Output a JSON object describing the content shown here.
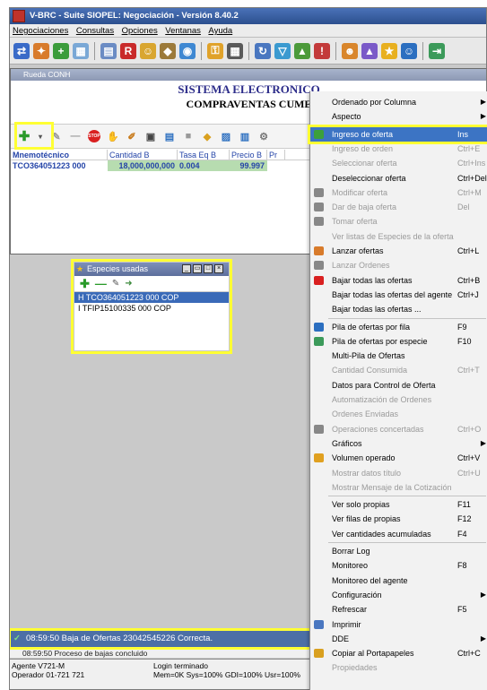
{
  "window": {
    "title": "V-BRC - Suite SIOPEL: Negociación - Versión 8.40.2"
  },
  "menubar": [
    "Negociaciones",
    "Consultas",
    "Opciones",
    "Ventanas",
    "Ayuda"
  ],
  "rueda": {
    "title": "Rueda CONH",
    "banner_line1": "SISTEMA ELECTRONICO",
    "banner_line2": "COMPRAVENTAS CUME",
    "columns": [
      "Mnemotécnico",
      "Cantidad B",
      "Tasa Eq B",
      "Precio B",
      "Pr"
    ],
    "row": {
      "mnemonic": "TCO364051223 000",
      "cantidad": "18,000,000,000",
      "tasa": "0.004",
      "precio": "99.997"
    }
  },
  "especies": {
    "title": "Especies usadas",
    "items": [
      {
        "text": "H TCO364051223 000 COP"
      },
      {
        "text": "I TFIP15100335 000 COP"
      }
    ]
  },
  "status": {
    "message": "08:59:50  Baja de Ofertas 23042545226 Correcta.",
    "log_line": "08:59:50  Proceso de bajas concluido",
    "agente": "Agente V721-M",
    "operador": "Operador 01-721 721",
    "login": "Login terminado",
    "mem": "Mem=0K Sys=100% GDI=100% Usr=100%"
  },
  "context_menu": {
    "items": [
      {
        "label": "Ordenado por Columna",
        "shortcut": "",
        "submenu": true,
        "disabled": false
      },
      {
        "label": "Aspecto",
        "shortcut": "",
        "submenu": true,
        "disabled": false
      },
      {
        "label": "Ingreso de oferta",
        "shortcut": "Ins",
        "submenu": false,
        "disabled": false,
        "highlighted": true
      },
      {
        "label": "Ingreso de orden",
        "shortcut": "Ctrl+E",
        "submenu": false,
        "disabled": true
      },
      {
        "label": "Seleccionar oferta",
        "shortcut": "Ctrl+Ins",
        "submenu": false,
        "disabled": true
      },
      {
        "label": "Deseleccionar oferta",
        "shortcut": "Ctrl+Del",
        "submenu": false,
        "disabled": false
      },
      {
        "label": "Modificar oferta",
        "shortcut": "Ctrl+M",
        "submenu": false,
        "disabled": true
      },
      {
        "label": "Dar de baja oferta",
        "shortcut": "Del",
        "submenu": false,
        "disabled": true
      },
      {
        "label": "Tomar oferta",
        "shortcut": "",
        "submenu": false,
        "disabled": true
      },
      {
        "label": "Ver listas de Especies de la oferta",
        "shortcut": "",
        "submenu": false,
        "disabled": true
      },
      {
        "label": "Lanzar ofertas",
        "shortcut": "Ctrl+L",
        "submenu": false,
        "disabled": false
      },
      {
        "label": "Lanzar Ordenes",
        "shortcut": "",
        "submenu": false,
        "disabled": true
      },
      {
        "label": "Bajar todas las ofertas",
        "shortcut": "Ctrl+B",
        "submenu": false,
        "disabled": false
      },
      {
        "label": "Bajar todas las ofertas del agente",
        "shortcut": "Ctrl+J",
        "submenu": false,
        "disabled": false
      },
      {
        "label": "Bajar todas las ofertas ...",
        "shortcut": "",
        "submenu": false,
        "disabled": false
      },
      {
        "label": "Pila de ofertas por fila",
        "shortcut": "F9",
        "submenu": false,
        "disabled": false
      },
      {
        "label": "Pila de ofertas por especie",
        "shortcut": "F10",
        "submenu": false,
        "disabled": false
      },
      {
        "label": "Multi-Pila de Ofertas",
        "shortcut": "",
        "submenu": false,
        "disabled": false
      },
      {
        "label": "Cantidad Consumida",
        "shortcut": "Ctrl+T",
        "submenu": false,
        "disabled": true
      },
      {
        "label": "Datos para Control de Oferta",
        "shortcut": "",
        "submenu": false,
        "disabled": false
      },
      {
        "label": "Automatización de Ordenes",
        "shortcut": "",
        "submenu": false,
        "disabled": true
      },
      {
        "label": "Ordenes Enviadas",
        "shortcut": "",
        "submenu": false,
        "disabled": true
      },
      {
        "label": "Operaciones concertadas",
        "shortcut": "Ctrl+O",
        "submenu": false,
        "disabled": true
      },
      {
        "label": "Gráficos",
        "shortcut": "",
        "submenu": true,
        "disabled": false
      },
      {
        "label": "Volumen operado",
        "shortcut": "Ctrl+V",
        "submenu": false,
        "disabled": false
      },
      {
        "label": "Mostrar datos título",
        "shortcut": "Ctrl+U",
        "submenu": false,
        "disabled": true
      },
      {
        "label": "Mostrar Mensaje de la Cotización",
        "shortcut": "",
        "submenu": false,
        "disabled": true
      },
      {
        "label": "Ver solo propias",
        "shortcut": "F11",
        "submenu": false,
        "disabled": false
      },
      {
        "label": "Ver filas de propias",
        "shortcut": "F12",
        "submenu": false,
        "disabled": false
      },
      {
        "label": "Ver cantidades acumuladas",
        "shortcut": "F4",
        "submenu": false,
        "disabled": false
      },
      {
        "label": "Borrar Log",
        "shortcut": "",
        "submenu": false,
        "disabled": false
      },
      {
        "label": "Monitoreo",
        "shortcut": "F8",
        "submenu": false,
        "disabled": false
      },
      {
        "label": "Monitoreo del agente",
        "shortcut": "",
        "submenu": false,
        "disabled": false
      },
      {
        "label": "Configuración",
        "shortcut": "",
        "submenu": true,
        "disabled": false
      },
      {
        "label": "Refrescar",
        "shortcut": "F5",
        "submenu": false,
        "disabled": false
      },
      {
        "label": "Imprimir",
        "shortcut": "",
        "submenu": false,
        "disabled": false
      },
      {
        "label": "DDE",
        "shortcut": "",
        "submenu": true,
        "disabled": false
      },
      {
        "label": "Copiar al Portapapeles",
        "shortcut": "Ctrl+C",
        "submenu": false,
        "disabled": false
      },
      {
        "label": "Propiedades",
        "shortcut": "",
        "submenu": false,
        "disabled": true
      }
    ]
  },
  "colors": {
    "highlight": "#ffff33",
    "menu_selected": "#3c74c4",
    "title": "#2c4f8e",
    "green_cell": "#b7dcb0"
  }
}
